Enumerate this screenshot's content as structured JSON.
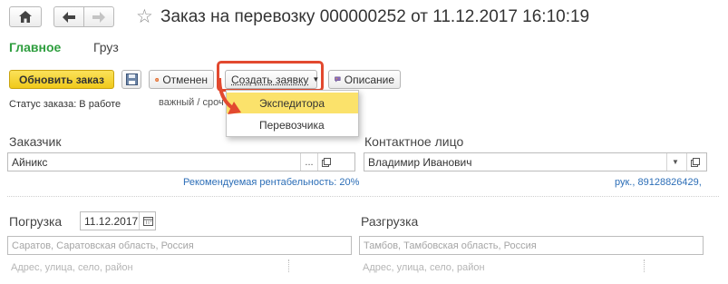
{
  "header": {
    "title": "Заказ на перевозку 000000252 от 11.12.2017 16:10:19",
    "home_icon": "home-icon",
    "back_icon": "arrow-left-icon",
    "forward_icon": "arrow-right-icon",
    "star_icon": "star-icon"
  },
  "tabs": [
    {
      "label": "Главное",
      "active": true
    },
    {
      "label": "Груз",
      "active": false
    }
  ],
  "toolbar": {
    "refresh_label": "Обновить заказ",
    "save_icon": "save-icon",
    "cancel_label": "Отменен",
    "cancel_icon": "cancel-x-icon",
    "create_label": "Создать заявку",
    "description_label": "Описание",
    "description_icon": "speech-bubble-icon"
  },
  "dropdown": {
    "items": [
      {
        "label": "Экспедитора",
        "active": true
      },
      {
        "label": "Перевозчика",
        "active": false
      }
    ]
  },
  "status": {
    "text": "Статус заказа: В работе",
    "tags": "важный / сроч"
  },
  "customer": {
    "label": "Заказчик",
    "value": "Айникс",
    "more": "...",
    "profitability": "Рекомендуемая рентабельность: 20%"
  },
  "contact": {
    "label": "Контактное лицо",
    "value": "Владимир Иванович",
    "phone": "рук., 89128826429,"
  },
  "loading": {
    "label": "Погрузка",
    "date": "11.12.2017",
    "address": "Саратов, Саратовская область, Россия",
    "street_placeholder": "Адрес, улица, село, район"
  },
  "unloading": {
    "label": "Разгрузка",
    "address": "Тамбов, Тамбовская область, Россия",
    "street_placeholder": "Адрес, улица, село, район"
  },
  "colors": {
    "accent_green": "#2e9e3e",
    "highlight_yellow": "#fbe26b",
    "link_blue": "#2c6eb7",
    "annotation_red": "#e2492f"
  }
}
